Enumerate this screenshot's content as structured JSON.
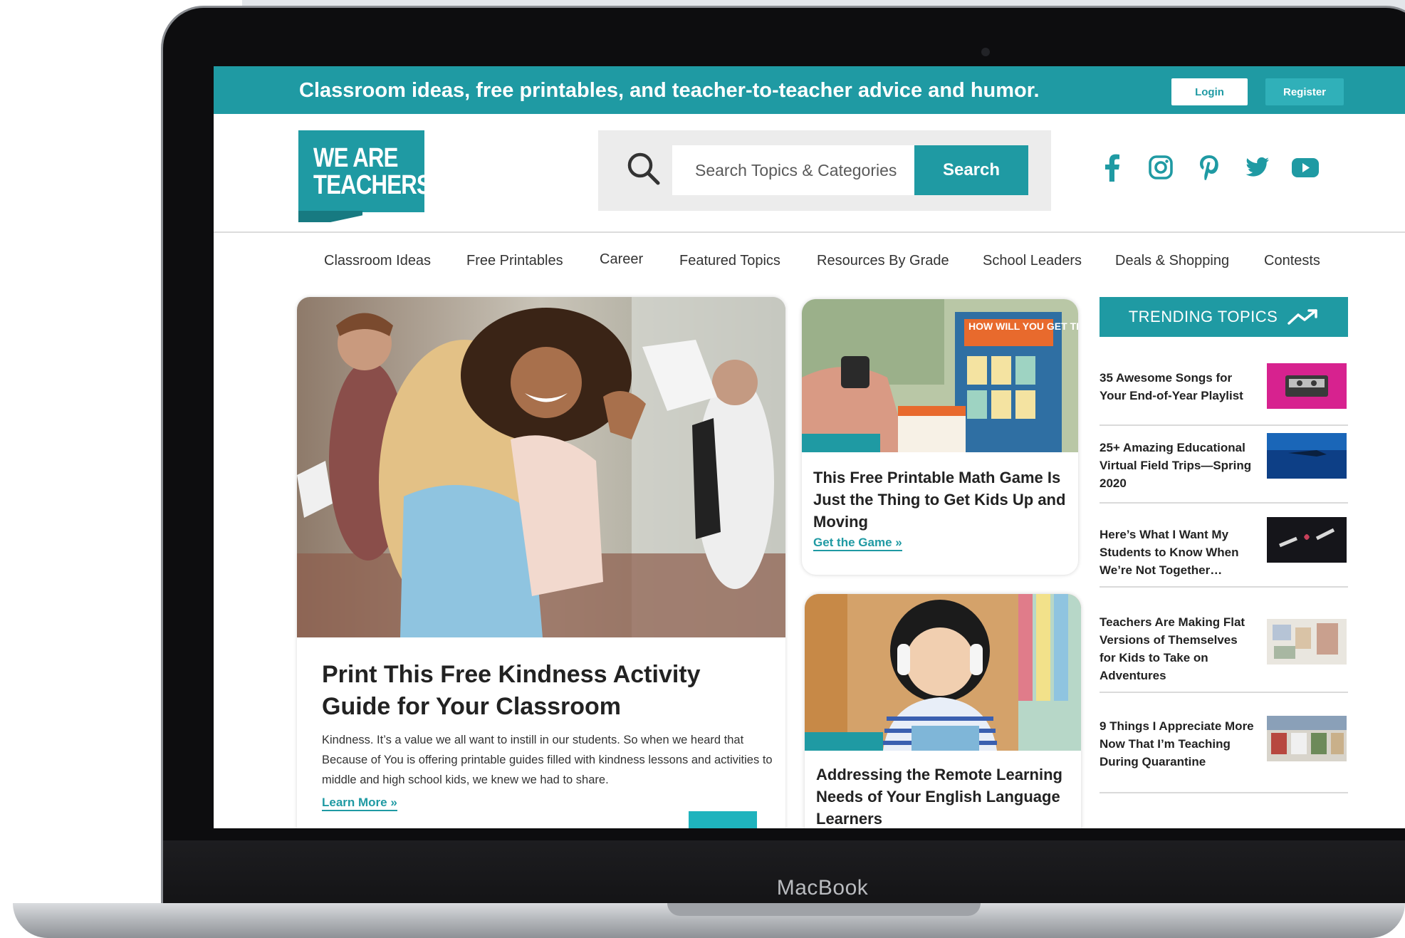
{
  "device": {
    "label": "MacBook"
  },
  "banner": {
    "tagline": "Classroom ideas, free printables, and teacher-to-teacher advice and humor.",
    "login_label": "Login",
    "register_label": "Register"
  },
  "logo": {
    "line1": "WE ARE",
    "line2": "TEACHERS"
  },
  "search": {
    "placeholder": "Search Topics & Categories",
    "button_label": "Search"
  },
  "social": [
    "facebook-icon",
    "instagram-icon",
    "pinterest-icon",
    "twitter-icon",
    "youtube-icon"
  ],
  "nav": {
    "items": [
      "Classroom Ideas",
      "Free Printables",
      "Career",
      "Featured Topics",
      "Resources By Grade",
      "School Leaders",
      "Deals & Shopping",
      "Contests"
    ]
  },
  "hero": {
    "title": "Print This Free Kindness Activity Guide for Your Classroom",
    "body": "Kindness. It’s a value we all want to instill in our students. So when we heard that Because of You is offering printable guides filled with kindness lessons and activities to middle and high school kids, we knew we had to share.",
    "link": "Learn More »"
  },
  "cards": [
    {
      "title": "This Free Printable Math Game Is Just the Thing to Get Kids Up and Moving",
      "link": "Get the Game »",
      "poster_text": "HOW WILL YOU GET THERE?"
    },
    {
      "title": "Addressing the Remote Learning Needs of Your English Language Learners"
    }
  ],
  "trending": {
    "heading": "TRENDING TOPICS",
    "items": [
      "35 Awesome Songs for Your End-of-Year Playlist",
      "25+ Amazing Educational Virtual Field Trips—Spring 2020",
      "Here’s What I Want My Students to Know When We’re Not Together…",
      "Teachers Are Making Flat Versions of Themselves for Kids to Take on Adventures",
      "9 Things I Appreciate More Now That I’m Teaching During Quarantine"
    ]
  },
  "colors": {
    "brand_teal": "#1f9aa3",
    "text_dark": "#222222"
  }
}
